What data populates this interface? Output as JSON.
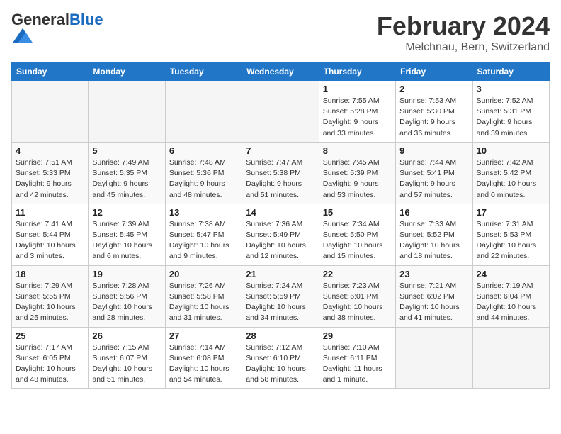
{
  "header": {
    "logo_general": "General",
    "logo_blue": "Blue",
    "month": "February 2024",
    "location": "Melchnau, Bern, Switzerland"
  },
  "weekdays": [
    "Sunday",
    "Monday",
    "Tuesday",
    "Wednesday",
    "Thursday",
    "Friday",
    "Saturday"
  ],
  "weeks": [
    [
      {
        "day": "",
        "empty": true
      },
      {
        "day": "",
        "empty": true
      },
      {
        "day": "",
        "empty": true
      },
      {
        "day": "",
        "empty": true
      },
      {
        "day": "1",
        "sunrise": "7:55 AM",
        "sunset": "5:28 PM",
        "daylight": "9 hours and 33 minutes."
      },
      {
        "day": "2",
        "sunrise": "7:53 AM",
        "sunset": "5:30 PM",
        "daylight": "9 hours and 36 minutes."
      },
      {
        "day": "3",
        "sunrise": "7:52 AM",
        "sunset": "5:31 PM",
        "daylight": "9 hours and 39 minutes."
      }
    ],
    [
      {
        "day": "4",
        "sunrise": "7:51 AM",
        "sunset": "5:33 PM",
        "daylight": "9 hours and 42 minutes."
      },
      {
        "day": "5",
        "sunrise": "7:49 AM",
        "sunset": "5:35 PM",
        "daylight": "9 hours and 45 minutes."
      },
      {
        "day": "6",
        "sunrise": "7:48 AM",
        "sunset": "5:36 PM",
        "daylight": "9 hours and 48 minutes."
      },
      {
        "day": "7",
        "sunrise": "7:47 AM",
        "sunset": "5:38 PM",
        "daylight": "9 hours and 51 minutes."
      },
      {
        "day": "8",
        "sunrise": "7:45 AM",
        "sunset": "5:39 PM",
        "daylight": "9 hours and 53 minutes."
      },
      {
        "day": "9",
        "sunrise": "7:44 AM",
        "sunset": "5:41 PM",
        "daylight": "9 hours and 57 minutes."
      },
      {
        "day": "10",
        "sunrise": "7:42 AM",
        "sunset": "5:42 PM",
        "daylight": "10 hours and 0 minutes."
      }
    ],
    [
      {
        "day": "11",
        "sunrise": "7:41 AM",
        "sunset": "5:44 PM",
        "daylight": "10 hours and 3 minutes."
      },
      {
        "day": "12",
        "sunrise": "7:39 AM",
        "sunset": "5:45 PM",
        "daylight": "10 hours and 6 minutes."
      },
      {
        "day": "13",
        "sunrise": "7:38 AM",
        "sunset": "5:47 PM",
        "daylight": "10 hours and 9 minutes."
      },
      {
        "day": "14",
        "sunrise": "7:36 AM",
        "sunset": "5:49 PM",
        "daylight": "10 hours and 12 minutes."
      },
      {
        "day": "15",
        "sunrise": "7:34 AM",
        "sunset": "5:50 PM",
        "daylight": "10 hours and 15 minutes."
      },
      {
        "day": "16",
        "sunrise": "7:33 AM",
        "sunset": "5:52 PM",
        "daylight": "10 hours and 18 minutes."
      },
      {
        "day": "17",
        "sunrise": "7:31 AM",
        "sunset": "5:53 PM",
        "daylight": "10 hours and 22 minutes."
      }
    ],
    [
      {
        "day": "18",
        "sunrise": "7:29 AM",
        "sunset": "5:55 PM",
        "daylight": "10 hours and 25 minutes."
      },
      {
        "day": "19",
        "sunrise": "7:28 AM",
        "sunset": "5:56 PM",
        "daylight": "10 hours and 28 minutes."
      },
      {
        "day": "20",
        "sunrise": "7:26 AM",
        "sunset": "5:58 PM",
        "daylight": "10 hours and 31 minutes."
      },
      {
        "day": "21",
        "sunrise": "7:24 AM",
        "sunset": "5:59 PM",
        "daylight": "10 hours and 34 minutes."
      },
      {
        "day": "22",
        "sunrise": "7:23 AM",
        "sunset": "6:01 PM",
        "daylight": "10 hours and 38 minutes."
      },
      {
        "day": "23",
        "sunrise": "7:21 AM",
        "sunset": "6:02 PM",
        "daylight": "10 hours and 41 minutes."
      },
      {
        "day": "24",
        "sunrise": "7:19 AM",
        "sunset": "6:04 PM",
        "daylight": "10 hours and 44 minutes."
      }
    ],
    [
      {
        "day": "25",
        "sunrise": "7:17 AM",
        "sunset": "6:05 PM",
        "daylight": "10 hours and 48 minutes."
      },
      {
        "day": "26",
        "sunrise": "7:15 AM",
        "sunset": "6:07 PM",
        "daylight": "10 hours and 51 minutes."
      },
      {
        "day": "27",
        "sunrise": "7:14 AM",
        "sunset": "6:08 PM",
        "daylight": "10 hours and 54 minutes."
      },
      {
        "day": "28",
        "sunrise": "7:12 AM",
        "sunset": "6:10 PM",
        "daylight": "10 hours and 58 minutes."
      },
      {
        "day": "29",
        "sunrise": "7:10 AM",
        "sunset": "6:11 PM",
        "daylight": "11 hours and 1 minute."
      },
      {
        "day": "",
        "empty": true
      },
      {
        "day": "",
        "empty": true
      }
    ]
  ]
}
